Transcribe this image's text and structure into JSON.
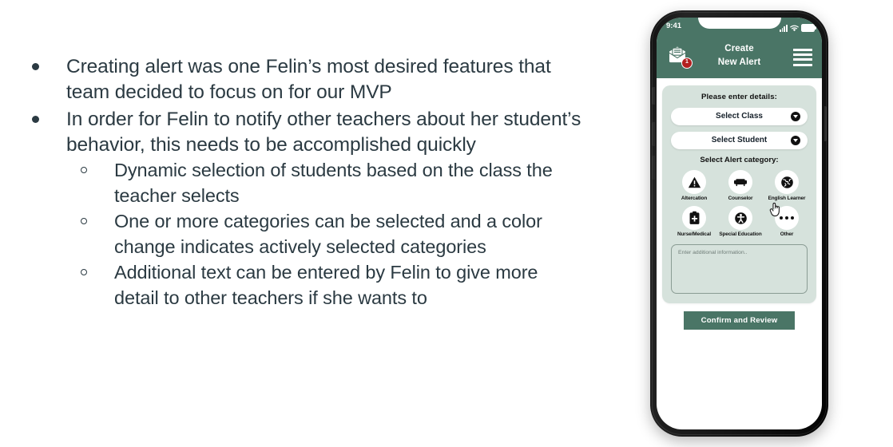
{
  "theme": {
    "brand_green": "#4a7566",
    "panel_green": "#d6e2dc",
    "badge_red": "#b32020",
    "text_dark": "#2b3a42"
  },
  "slide": {
    "bullets": [
      {
        "text": "Creating alert was one Felin’s most desired features that team decided to focus on for our MVP",
        "sub": []
      },
      {
        "text": "In order for Felin to notify other teachers about her student’s behavior, this needs to be accomplished quickly",
        "sub": [
          "Dynamic selection of students based on the class the teacher selects",
          "One or more categories can be selected and a color change indicates actively selected categories",
          "Additional text can be entered by Felin to give more detail to other teachers if she wants to"
        ]
      }
    ]
  },
  "phone": {
    "status_bar": {
      "time": "9:41",
      "signal_icon": "signal-bars-icon",
      "wifi_icon": "wifi-icon",
      "battery_icon": "battery-icon"
    },
    "header": {
      "title_line1": "Create",
      "title_line2": "New Alert",
      "mail_icon": "mail-envelope-icon",
      "badge_count": "1",
      "menu_icon": "hamburger-menu-icon"
    },
    "form": {
      "heading": "Please enter details:",
      "selects": [
        {
          "label": "Select Class",
          "caret_icon": "chevron-down-circle-icon"
        },
        {
          "label": "Select Student",
          "caret_icon": "chevron-down-circle-icon"
        }
      ],
      "category_heading": "Select Alert category:",
      "categories": [
        {
          "label": "Altercation",
          "icon": "warning-triangle-icon"
        },
        {
          "label": "Counselor",
          "icon": "couch-icon"
        },
        {
          "label": "English Learner",
          "icon": "globe-icon"
        },
        {
          "label": "Nurse/Medical",
          "icon": "medical-clipboard-icon"
        },
        {
          "label": "Special Education",
          "icon": "accessibility-person-icon"
        },
        {
          "label": "Other",
          "icon": "three-dots-icon"
        }
      ],
      "note_placeholder": "Enter additional information..",
      "submit_label": "Confirm and Review",
      "cursor_icon": "pointing-hand-cursor-icon"
    }
  }
}
